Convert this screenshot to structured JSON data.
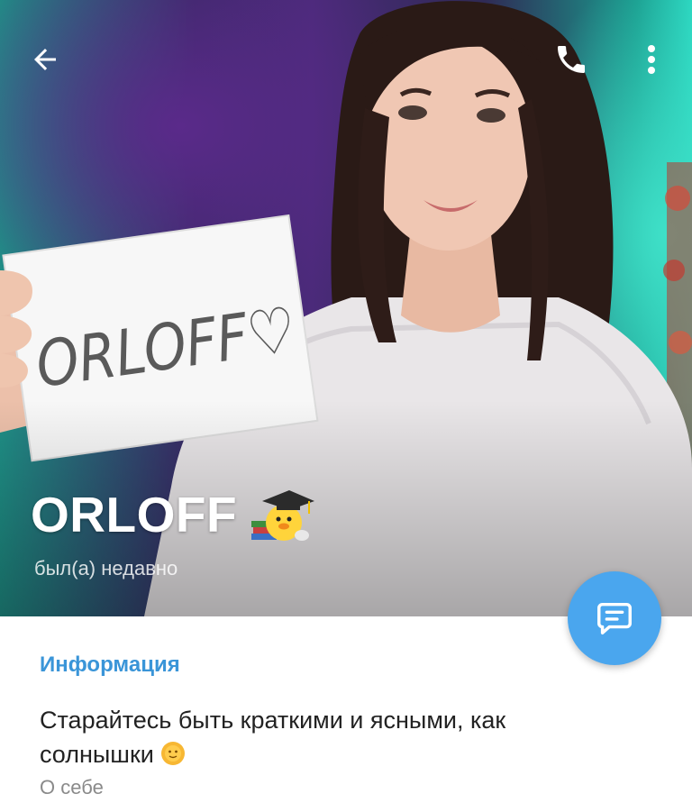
{
  "header": {
    "name": "ORLOFF",
    "status": "был(а) недавно",
    "photo_sign_text": "ORLOFF♡"
  },
  "topbar": {
    "back_icon": "arrow-left-icon",
    "call_icon": "phone-icon",
    "more_icon": "more-vertical-icon"
  },
  "fab": {
    "icon": "message-icon",
    "color": "#4aa6ee"
  },
  "info": {
    "section_title": "Информация",
    "bio_line1": "Старайтесь быть краткими и ясными, как",
    "bio_line2": "солнышки",
    "bio_emoji": "sun-emoji",
    "bio_caption": "О себе"
  },
  "colors": {
    "accent": "#3a95d8",
    "fab": "#4aa6ee"
  }
}
